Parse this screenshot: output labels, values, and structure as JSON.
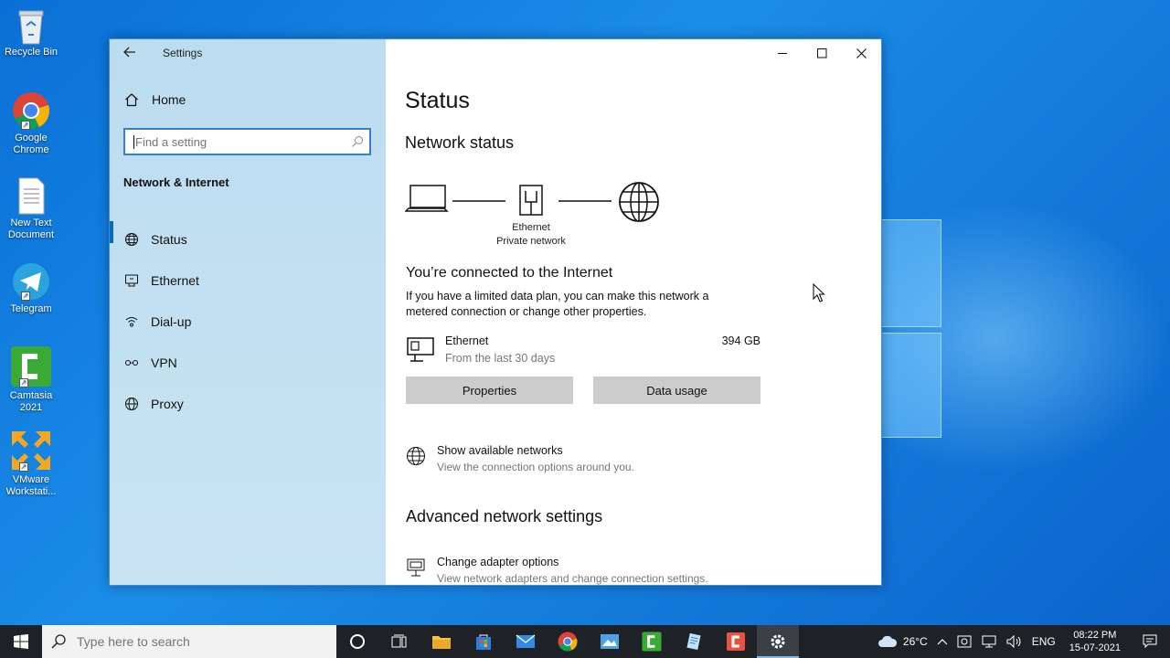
{
  "desktop": {
    "icons": [
      {
        "label": "Recycle Bin",
        "icon": "recycle-bin-icon"
      },
      {
        "label": "Google Chrome",
        "icon": "chrome-icon"
      },
      {
        "label": "New Text Document",
        "icon": "text-document-icon"
      },
      {
        "label": "Telegram",
        "icon": "telegram-icon"
      },
      {
        "label": "Camtasia 2021",
        "icon": "camtasia-icon"
      },
      {
        "label": "VMware Workstati...",
        "icon": "vmware-icon"
      }
    ]
  },
  "window": {
    "app_title": "Settings",
    "home_label": "Home",
    "search_placeholder": "Find a setting",
    "section_title": "Network & Internet",
    "nav": [
      {
        "label": "Status",
        "icon": "globe-icon",
        "active": true
      },
      {
        "label": "Ethernet",
        "icon": "ethernet-icon"
      },
      {
        "label": "Dial-up",
        "icon": "dialup-icon"
      },
      {
        "label": "VPN",
        "icon": "vpn-icon"
      },
      {
        "label": "Proxy",
        "icon": "globe-icon"
      }
    ]
  },
  "main": {
    "page_title": "Status",
    "network_status_title": "Network status",
    "diagram": {
      "adapter": "Ethernet",
      "profile": "Private network"
    },
    "connected_title": "You’re connected to the Internet",
    "connected_desc": "If you have a limited data plan, you can make this network a metered connection or change other properties.",
    "ethernet": {
      "name": "Ethernet",
      "sub": "From the last 30 days",
      "usage": "394 GB"
    },
    "buttons": {
      "properties": "Properties",
      "data_usage": "Data usage"
    },
    "show_networks": {
      "title": "Show available networks",
      "sub": "View the connection options around you."
    },
    "advanced_title": "Advanced network settings",
    "change_adapter": {
      "title": "Change adapter options",
      "sub": "View network adapters and change connection settings."
    }
  },
  "taskbar": {
    "search_placeholder": "Type here to search",
    "apps": [
      "task-view-icon",
      "file-explorer-icon",
      "store-icon",
      "mail-icon",
      "chrome-icon",
      "photos-icon",
      "camtasia-icon",
      "notepad-icon",
      "camtasia-recorder-icon",
      "settings-icon"
    ],
    "weather": "26°C",
    "language": "ENG",
    "time": "08:22 PM",
    "date": "15-07-2021"
  }
}
